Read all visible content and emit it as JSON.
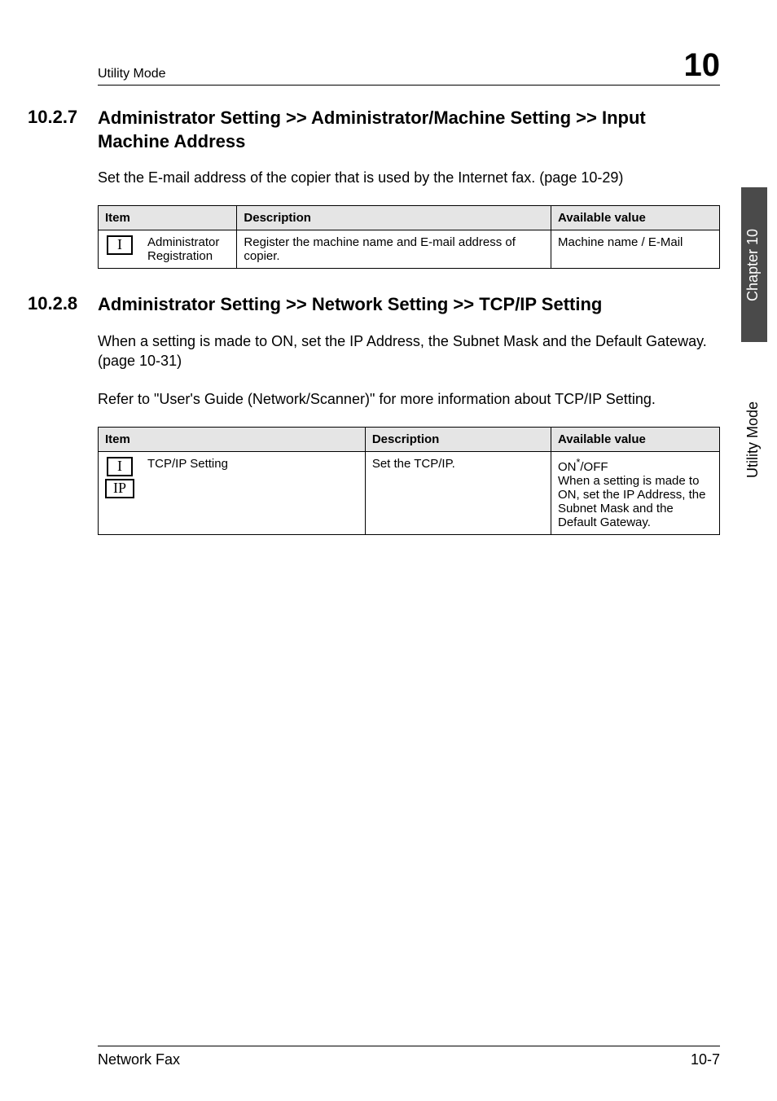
{
  "header": {
    "left": "Utility Mode",
    "right": "10"
  },
  "section1": {
    "number": "10.2.7",
    "title": "Administrator Setting >> Administrator/Machine Setting >> Input Machine Address",
    "paragraph": "Set the E-mail address of the copier that is used by the Internet fax. (page 10-29)",
    "table": {
      "headers": {
        "item": "Item",
        "desc": "Description",
        "avail": "Available value"
      },
      "row": {
        "icons": [
          "I"
        ],
        "label": "Administrator Registration",
        "desc": "Register the machine name and E-mail address of copier.",
        "avail": "Machine name / E-Mail"
      }
    }
  },
  "section2": {
    "number": "10.2.8",
    "title": "Administrator Setting >> Network Setting >> TCP/IP Setting",
    "paragraph1": "When a setting is made to ON, set the IP Address, the Subnet Mask and the Default Gateway. (page 10-31)",
    "paragraph2": "Refer to \"User's Guide (Network/Scanner)\" for more information about TCP/IP Setting.",
    "table": {
      "headers": {
        "item": "Item",
        "desc": "Description",
        "avail": "Available value"
      },
      "row": {
        "icons": [
          "I",
          "IP"
        ],
        "label": "TCP/IP Setting",
        "desc": "Set the TCP/IP.",
        "avail_prefix": "ON",
        "avail_suffix": "/OFF\nWhen a setting is made to ON, set the IP Address, the Subnet Mask and the Default Gateway."
      }
    }
  },
  "sidebar": {
    "dark": "Chapter 10",
    "light": "Utility Mode"
  },
  "footer": {
    "left": "Network Fax",
    "right": "10-7"
  }
}
